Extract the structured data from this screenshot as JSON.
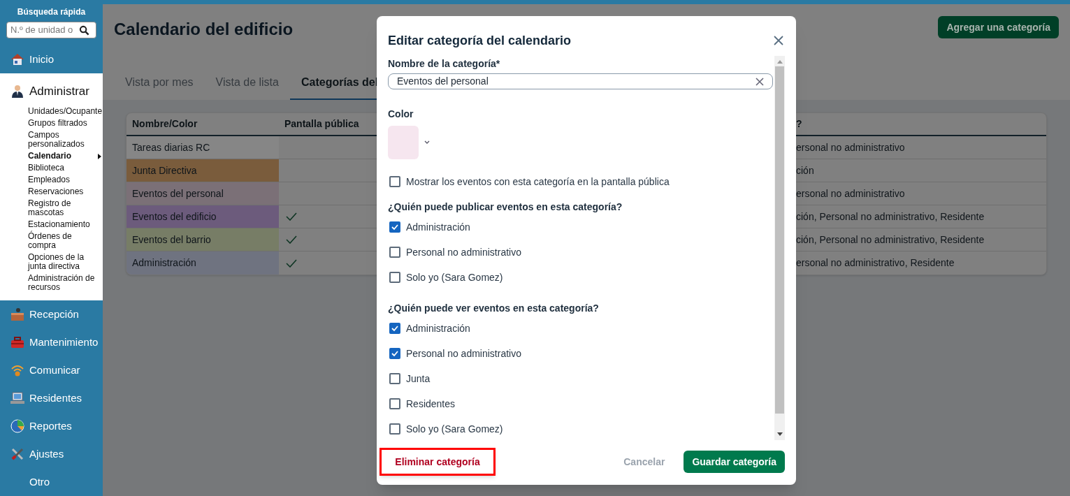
{
  "sidebar": {
    "search_title": "Búsqueda rápida",
    "search": {
      "placeholder": "N.º de unidad o"
    },
    "items": [
      {
        "label": "Inicio",
        "expanded": false
      },
      {
        "label": "Administrar",
        "expanded": true,
        "children": [
          {
            "label": "Unidades/Ocupante",
            "selected": false
          },
          {
            "label": "Grupos filtrados",
            "selected": false
          },
          {
            "label": "Campos personalizados",
            "selected": false
          },
          {
            "label": "Calendario",
            "selected": true
          },
          {
            "label": "Biblioteca",
            "selected": false
          },
          {
            "label": "Empleados",
            "selected": false
          },
          {
            "label": "Reservaciones",
            "selected": false
          },
          {
            "label": "Registro de mascotas",
            "selected": false
          },
          {
            "label": "Estacionamiento",
            "selected": false
          },
          {
            "label": "Órdenes de compra",
            "selected": false
          },
          {
            "label": "Opciones de la junta directiva",
            "selected": false
          },
          {
            "label": "Administración de recursos",
            "selected": false
          }
        ]
      },
      {
        "label": "Recepción",
        "expanded": false
      },
      {
        "label": "Mantenimiento",
        "expanded": false
      },
      {
        "label": "Comunicar",
        "expanded": false
      },
      {
        "label": "Residentes",
        "expanded": false
      },
      {
        "label": "Reportes",
        "expanded": false
      },
      {
        "label": "Ajustes",
        "expanded": false
      },
      {
        "label": "Otro",
        "expanded": false
      }
    ]
  },
  "page_title": "Calendario del edificio",
  "add_button": "Agregar una categoría",
  "tabs": [
    {
      "label": "Vista por mes",
      "selected": false
    },
    {
      "label": "Vista de lista",
      "selected": false
    },
    {
      "label": "Categorías del",
      "selected": true
    }
  ],
  "table": {
    "columns": [
      "Nombre/Color",
      "Pantalla pública",
      "?"
    ],
    "rows": [
      {
        "name": "Tareas diarias RC",
        "color": "#868686",
        "public": false,
        "column_3": "ersonal no administrativo"
      },
      {
        "name": "Junta Directiva",
        "color": "#7a5c3c",
        "public": false,
        "column_3": "ción"
      },
      {
        "name": "Eventos del personal",
        "color": "#7b7077",
        "public": false,
        "column_3": "ersonal no administrativo"
      },
      {
        "name": "Eventos del edificio",
        "color": "#6c5b7c",
        "public": true,
        "column_3": "ción, Personal no administrativo, Residente"
      },
      {
        "name": "Eventos del barrio",
        "color": "#777d66",
        "public": true,
        "column_3": "ción, Personal no administrativo, Residente"
      },
      {
        "name": "Administración",
        "color": "#6f7380",
        "public": true,
        "column_3": "ersonal no administrativo, Residente"
      }
    ]
  },
  "dialog": {
    "title": "Editar categoría del calendario",
    "name_field": {
      "label": "Nombre de la categoría*",
      "value": "Eventos del personal"
    },
    "color_field": {
      "label": "Color",
      "color": "#f6e6ef"
    },
    "show_public": {
      "label": "Mostrar los eventos con esta categoría en la pantalla pública",
      "checked": false
    },
    "groups": [
      {
        "title": "¿Quién puede publicar eventos en esta categoría?",
        "options": [
          {
            "label": "Administración",
            "checked": true
          },
          {
            "label": "Personal no administrativo",
            "checked": false
          },
          {
            "label": "Solo yo (Sara Gomez)",
            "checked": false
          }
        ]
      },
      {
        "title": "¿Quién puede ver eventos en esta categoría?",
        "options": [
          {
            "label": "Administración",
            "checked": true
          },
          {
            "label": "Personal no administrativo",
            "checked": true
          },
          {
            "label": "Junta",
            "checked": false
          },
          {
            "label": "Residentes",
            "checked": false
          },
          {
            "label": "Solo yo (Sara Gomez)",
            "checked": false
          }
        ]
      }
    ],
    "delete_button": {
      "label": "Eliminar categoría",
      "highlighted": true
    },
    "cancel_button": "Cancelar",
    "save_button": "Guardar categoría"
  }
}
